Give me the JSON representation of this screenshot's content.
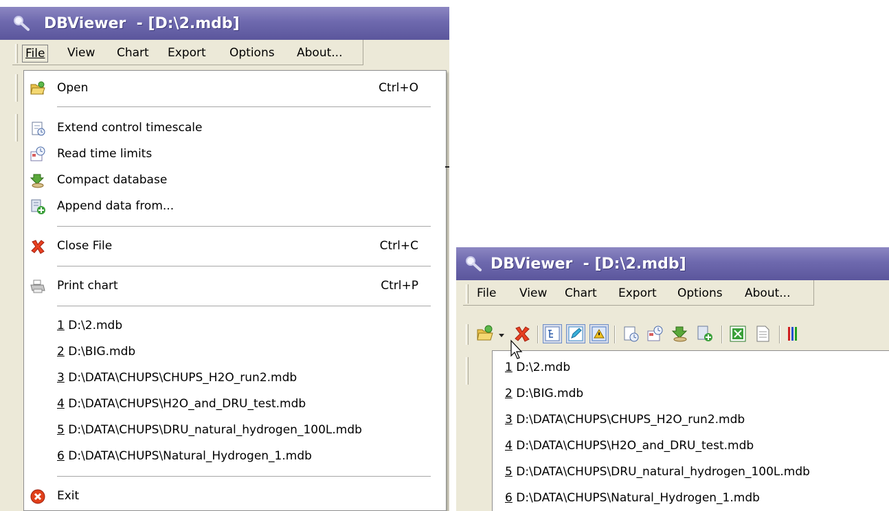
{
  "window_title": "DBViewer  - [D:\\2.mdb]",
  "menu": [
    "File",
    "View",
    "Chart",
    "Export",
    "Options",
    "About..."
  ],
  "file_menu": {
    "open": {
      "label": "Open",
      "shortcut": "Ctrl+O"
    },
    "extend": {
      "label": "Extend control timescale"
    },
    "read_limits": {
      "label": "Read time limits"
    },
    "compact": {
      "label": "Compact database"
    },
    "append": {
      "label": "Append data from..."
    },
    "close": {
      "label": "Close File",
      "shortcut": "Ctrl+C"
    },
    "print": {
      "label": "Print chart",
      "shortcut": "Ctrl+P"
    },
    "exit": {
      "label": "Exit"
    }
  },
  "recent_files": [
    {
      "num": "1",
      "path": " D:\\2.mdb"
    },
    {
      "num": "2",
      "path": " D:\\BIG.mdb"
    },
    {
      "num": "3",
      "path": " D:\\DATA\\CHUPS\\CHUPS_H2O_run2.mdb"
    },
    {
      "num": "4",
      "path": " D:\\DATA\\CHUPS\\H2O_and_DRU_test.mdb"
    },
    {
      "num": "5",
      "path": " D:\\DATA\\CHUPS\\DRU_natural_hydrogen_100L.mdb"
    },
    {
      "num": "6",
      "path": " D:\\DATA\\CHUPS\\Natural_Hydrogen_1.mdb"
    }
  ],
  "toolbar_icons": [
    "open-icon",
    "dropdown-arrow-icon",
    "close-file-icon",
    "tree-view-icon",
    "edit-icon",
    "alert-icon",
    "extend-timescale-icon",
    "read-time-limits-icon",
    "compact-database-icon",
    "append-data-icon",
    "export-excel-icon",
    "export-document-icon",
    "chart-icon"
  ],
  "colors": {
    "title_bar": "#6e69ae",
    "menu_bg": "#ece9d8",
    "popup_bg": "#ffffff"
  }
}
